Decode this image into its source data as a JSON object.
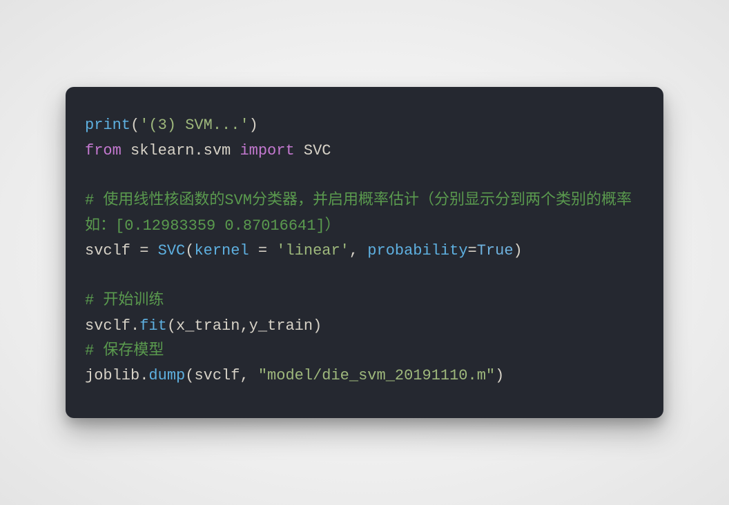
{
  "code": {
    "line1": {
      "fn": "print",
      "lp": "(",
      "str": "'(3) SVM...'",
      "rp": ")"
    },
    "line2": {
      "kw1": "from",
      "mod": " sklearn.svm ",
      "kw2": "import",
      "cls": " SVC"
    },
    "line3": "",
    "line4": {
      "comment": "# 使用线性核函数的SVM分类器，并启用概率估计（分别显示分到两个类别的概率如：[0.12983359 0.87016641]）"
    },
    "line5": {
      "lhs": "svclf ",
      "eq": "=",
      "sp": " ",
      "cls": "SVC",
      "lp": "(",
      "p1": "kernel",
      "sp2": " ",
      "eq2": "=",
      "sp3": " ",
      "v1": "'linear'",
      "comma": ", ",
      "p2": "probability",
      "eq3": "=",
      "v2": "True",
      "rp": ")"
    },
    "line6": "",
    "line7": {
      "comment": "# 开始训练"
    },
    "line8": {
      "obj": "svclf",
      "dot": ".",
      "m": "fit",
      "lp": "(",
      "a1": "x_train",
      "comma": ",",
      "a2": "y_train",
      "rp": ")"
    },
    "line9": {
      "comment": "# 保存模型"
    },
    "line10": {
      "obj": "joblib",
      "dot": ".",
      "m": "dump",
      "lp": "(",
      "a1": "svclf",
      "comma": ", ",
      "a2": "\"model/die_svm_20191110.m\"",
      "rp": ")"
    }
  }
}
